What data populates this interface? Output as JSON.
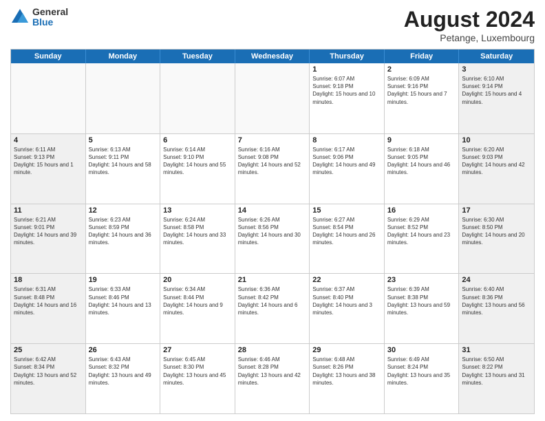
{
  "logo": {
    "general": "General",
    "blue": "Blue"
  },
  "title": "August 2024",
  "location": "Petange, Luxembourg",
  "header_days": [
    "Sunday",
    "Monday",
    "Tuesday",
    "Wednesday",
    "Thursday",
    "Friday",
    "Saturday"
  ],
  "weeks": [
    [
      {
        "day": "",
        "info": ""
      },
      {
        "day": "",
        "info": ""
      },
      {
        "day": "",
        "info": ""
      },
      {
        "day": "",
        "info": ""
      },
      {
        "day": "1",
        "info": "Sunrise: 6:07 AM\nSunset: 9:18 PM\nDaylight: 15 hours and 10 minutes."
      },
      {
        "day": "2",
        "info": "Sunrise: 6:09 AM\nSunset: 9:16 PM\nDaylight: 15 hours and 7 minutes."
      },
      {
        "day": "3",
        "info": "Sunrise: 6:10 AM\nSunset: 9:14 PM\nDaylight: 15 hours and 4 minutes."
      }
    ],
    [
      {
        "day": "4",
        "info": "Sunrise: 6:11 AM\nSunset: 9:13 PM\nDaylight: 15 hours and 1 minute."
      },
      {
        "day": "5",
        "info": "Sunrise: 6:13 AM\nSunset: 9:11 PM\nDaylight: 14 hours and 58 minutes."
      },
      {
        "day": "6",
        "info": "Sunrise: 6:14 AM\nSunset: 9:10 PM\nDaylight: 14 hours and 55 minutes."
      },
      {
        "day": "7",
        "info": "Sunrise: 6:16 AM\nSunset: 9:08 PM\nDaylight: 14 hours and 52 minutes."
      },
      {
        "day": "8",
        "info": "Sunrise: 6:17 AM\nSunset: 9:06 PM\nDaylight: 14 hours and 49 minutes."
      },
      {
        "day": "9",
        "info": "Sunrise: 6:18 AM\nSunset: 9:05 PM\nDaylight: 14 hours and 46 minutes."
      },
      {
        "day": "10",
        "info": "Sunrise: 6:20 AM\nSunset: 9:03 PM\nDaylight: 14 hours and 42 minutes."
      }
    ],
    [
      {
        "day": "11",
        "info": "Sunrise: 6:21 AM\nSunset: 9:01 PM\nDaylight: 14 hours and 39 minutes."
      },
      {
        "day": "12",
        "info": "Sunrise: 6:23 AM\nSunset: 8:59 PM\nDaylight: 14 hours and 36 minutes."
      },
      {
        "day": "13",
        "info": "Sunrise: 6:24 AM\nSunset: 8:58 PM\nDaylight: 14 hours and 33 minutes."
      },
      {
        "day": "14",
        "info": "Sunrise: 6:26 AM\nSunset: 8:56 PM\nDaylight: 14 hours and 30 minutes."
      },
      {
        "day": "15",
        "info": "Sunrise: 6:27 AM\nSunset: 8:54 PM\nDaylight: 14 hours and 26 minutes."
      },
      {
        "day": "16",
        "info": "Sunrise: 6:29 AM\nSunset: 8:52 PM\nDaylight: 14 hours and 23 minutes."
      },
      {
        "day": "17",
        "info": "Sunrise: 6:30 AM\nSunset: 8:50 PM\nDaylight: 14 hours and 20 minutes."
      }
    ],
    [
      {
        "day": "18",
        "info": "Sunrise: 6:31 AM\nSunset: 8:48 PM\nDaylight: 14 hours and 16 minutes."
      },
      {
        "day": "19",
        "info": "Sunrise: 6:33 AM\nSunset: 8:46 PM\nDaylight: 14 hours and 13 minutes."
      },
      {
        "day": "20",
        "info": "Sunrise: 6:34 AM\nSunset: 8:44 PM\nDaylight: 14 hours and 9 minutes."
      },
      {
        "day": "21",
        "info": "Sunrise: 6:36 AM\nSunset: 8:42 PM\nDaylight: 14 hours and 6 minutes."
      },
      {
        "day": "22",
        "info": "Sunrise: 6:37 AM\nSunset: 8:40 PM\nDaylight: 14 hours and 3 minutes."
      },
      {
        "day": "23",
        "info": "Sunrise: 6:39 AM\nSunset: 8:38 PM\nDaylight: 13 hours and 59 minutes."
      },
      {
        "day": "24",
        "info": "Sunrise: 6:40 AM\nSunset: 8:36 PM\nDaylight: 13 hours and 56 minutes."
      }
    ],
    [
      {
        "day": "25",
        "info": "Sunrise: 6:42 AM\nSunset: 8:34 PM\nDaylight: 13 hours and 52 minutes."
      },
      {
        "day": "26",
        "info": "Sunrise: 6:43 AM\nSunset: 8:32 PM\nDaylight: 13 hours and 49 minutes."
      },
      {
        "day": "27",
        "info": "Sunrise: 6:45 AM\nSunset: 8:30 PM\nDaylight: 13 hours and 45 minutes."
      },
      {
        "day": "28",
        "info": "Sunrise: 6:46 AM\nSunset: 8:28 PM\nDaylight: 13 hours and 42 minutes."
      },
      {
        "day": "29",
        "info": "Sunrise: 6:48 AM\nSunset: 8:26 PM\nDaylight: 13 hours and 38 minutes."
      },
      {
        "day": "30",
        "info": "Sunrise: 6:49 AM\nSunset: 8:24 PM\nDaylight: 13 hours and 35 minutes."
      },
      {
        "day": "31",
        "info": "Sunrise: 6:50 AM\nSunset: 8:22 PM\nDaylight: 13 hours and 31 minutes."
      }
    ]
  ]
}
